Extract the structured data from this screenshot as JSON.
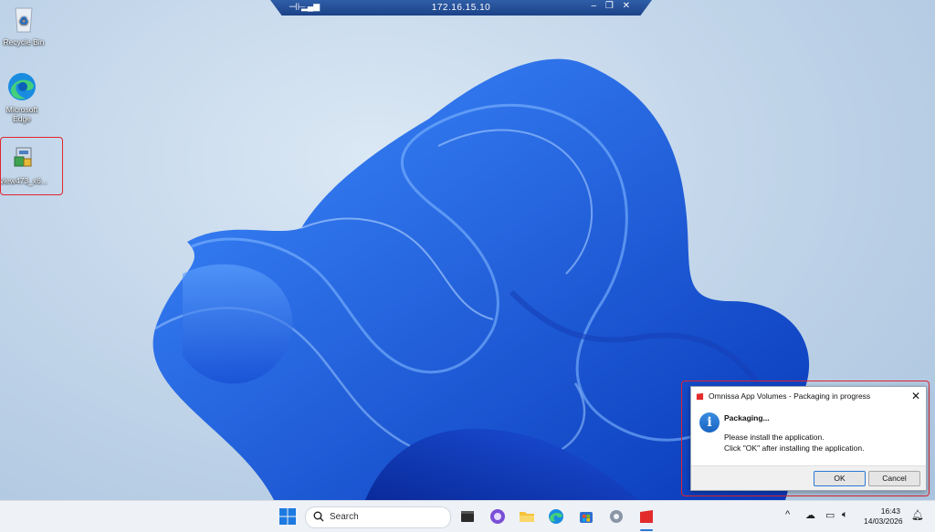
{
  "rdp_bar": {
    "host": "172.16.15.10",
    "pin_icon": "pin-icon",
    "signal_icon": "signal-icon"
  },
  "desktop": {
    "icons": [
      {
        "label": "Recycle Bin",
        "icon": "recycle-bin-icon"
      },
      {
        "label": "Microsoft Edge",
        "icon": "edge-icon"
      },
      {
        "label": "view473_x6...",
        "icon": "installer-icon"
      }
    ]
  },
  "dialog": {
    "title": "Omnissa App Volumes - Packaging in progress",
    "heading": "Packaging...",
    "line1": "Please install the application.",
    "line2": "Click \"OK\" after installing the application.",
    "ok_label": "OK",
    "cancel_label": "Cancel",
    "close_glyph": "✕"
  },
  "taskbar": {
    "search_placeholder": "Search",
    "apps": [
      "start-icon",
      "search-icon",
      "terminal-icon",
      "copilot-icon",
      "file-explorer-icon",
      "edge-icon",
      "store-icon",
      "settings-icon",
      "app-volumes-icon"
    ],
    "clock_time": "16:43",
    "clock_date": "14/03/2026"
  },
  "colors": {
    "accent": "#2a78d4",
    "highlight": "#e0252d",
    "rdp_bar": "#1c4288"
  }
}
